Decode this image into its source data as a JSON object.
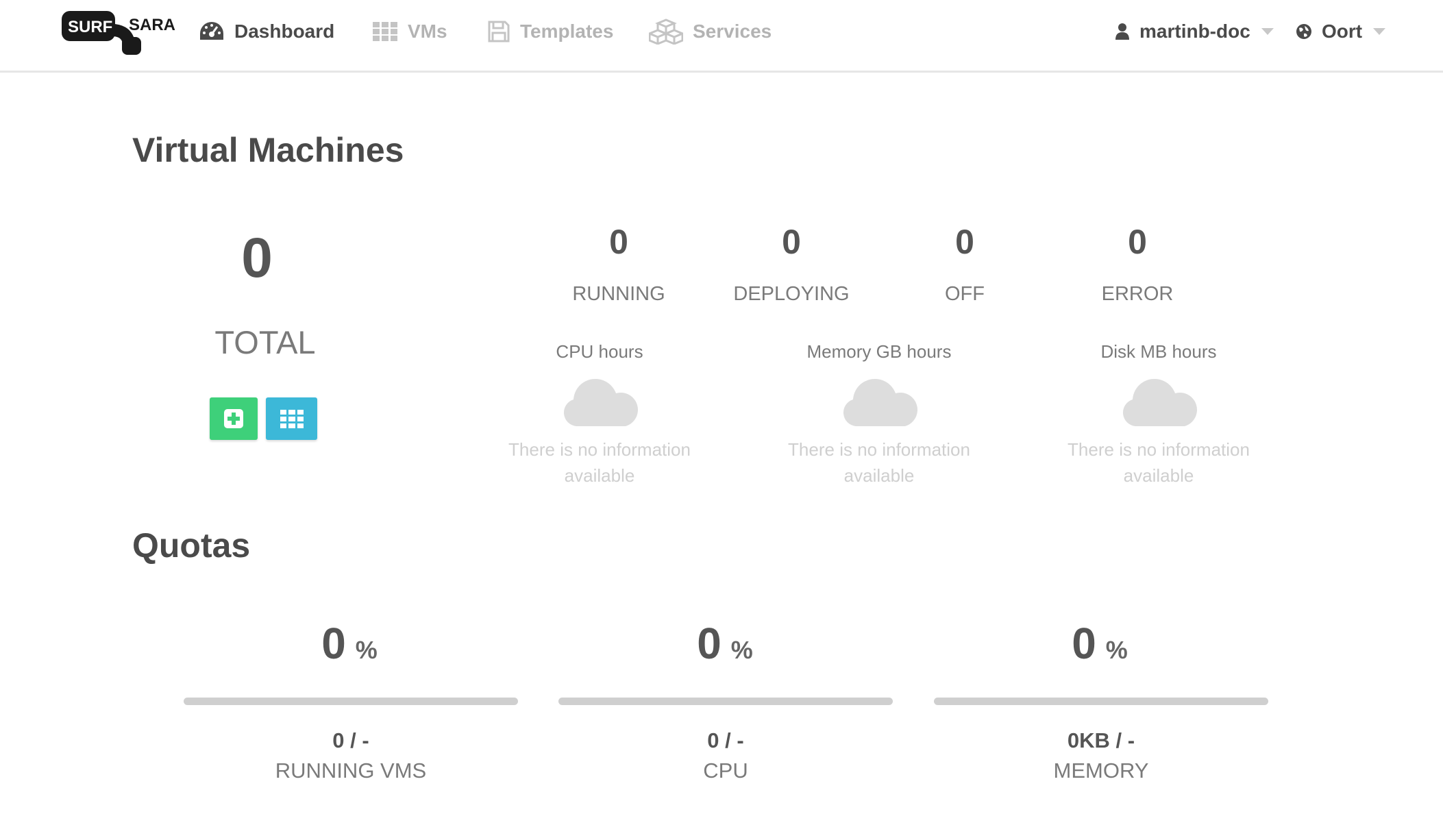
{
  "brand": {
    "line1": "SURF",
    "line2": "SARA",
    "color": "#1a1a1a"
  },
  "nav": {
    "items": [
      {
        "label": "Dashboard",
        "icon": "dashboard-icon",
        "active": true
      },
      {
        "label": "VMs",
        "icon": "grid-icon",
        "active": false
      },
      {
        "label": "Templates",
        "icon": "save-icon",
        "active": false
      },
      {
        "label": "Services",
        "icon": "cubes-icon",
        "active": false
      }
    ],
    "user": {
      "label": "martinb-doc",
      "icon": "user-icon"
    },
    "zone": {
      "label": "Oort",
      "icon": "globe-icon"
    }
  },
  "vms": {
    "title": "Virtual Machines",
    "total": {
      "value": "0",
      "label": "TOTAL"
    },
    "states": [
      {
        "value": "0",
        "label": "RUNNING"
      },
      {
        "value": "0",
        "label": "DEPLOYING"
      },
      {
        "value": "0",
        "label": "OFF"
      },
      {
        "value": "0",
        "label": "ERROR"
      }
    ],
    "metrics": [
      {
        "title": "CPU hours",
        "empty_text": "There is no information available"
      },
      {
        "title": "Memory GB hours",
        "empty_text": "There is no information available"
      },
      {
        "title": "Disk MB hours",
        "empty_text": "There is no information available"
      }
    ],
    "buttons": {
      "create_icon": "plus-square-icon",
      "list_icon": "grid-icon",
      "create_color": "#3ed07a",
      "list_color": "#3cb8d8"
    }
  },
  "quotas": {
    "title": "Quotas",
    "items": [
      {
        "percent": "0",
        "unit": "%",
        "fraction": 0,
        "value": "0 / -",
        "label": "RUNNING VMS"
      },
      {
        "percent": "0",
        "unit": "%",
        "fraction": 0,
        "value": "0 / -",
        "label": "CPU"
      },
      {
        "percent": "0",
        "unit": "%",
        "fraction": 0,
        "value": "0KB / -",
        "label": "MEMORY"
      }
    ]
  }
}
